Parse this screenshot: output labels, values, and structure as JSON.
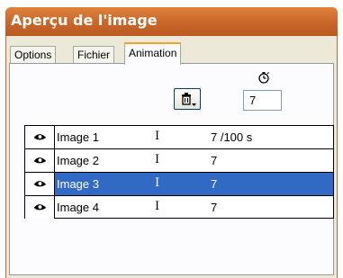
{
  "window": {
    "title": "Aperçu de l'image"
  },
  "tabs": [
    {
      "label": "Options",
      "active": false
    },
    {
      "label": "Fichier",
      "active": false
    },
    {
      "label": "Animation",
      "active": true
    }
  ],
  "toolbar": {
    "delete_icon": "trash-icon",
    "timer_icon": "stopwatch-icon",
    "delay_value": "7"
  },
  "frames": [
    {
      "visible_icon": "eye-icon",
      "name": "Image 1",
      "flag": "I",
      "delay": "7 /100 s",
      "selected": false
    },
    {
      "visible_icon": "eye-icon",
      "name": "Image 2",
      "flag": "I",
      "delay": "7",
      "selected": false
    },
    {
      "visible_icon": "eye-icon",
      "name": "Image 3",
      "flag": "I",
      "delay": "7",
      "selected": true
    },
    {
      "visible_icon": "eye-icon",
      "name": "Image 4",
      "flag": "I",
      "delay": "7",
      "selected": false
    }
  ],
  "colors": {
    "title_bar": "#c9662a",
    "selection": "#316ac5",
    "active_tab_accent": "#f4a12b"
  }
}
